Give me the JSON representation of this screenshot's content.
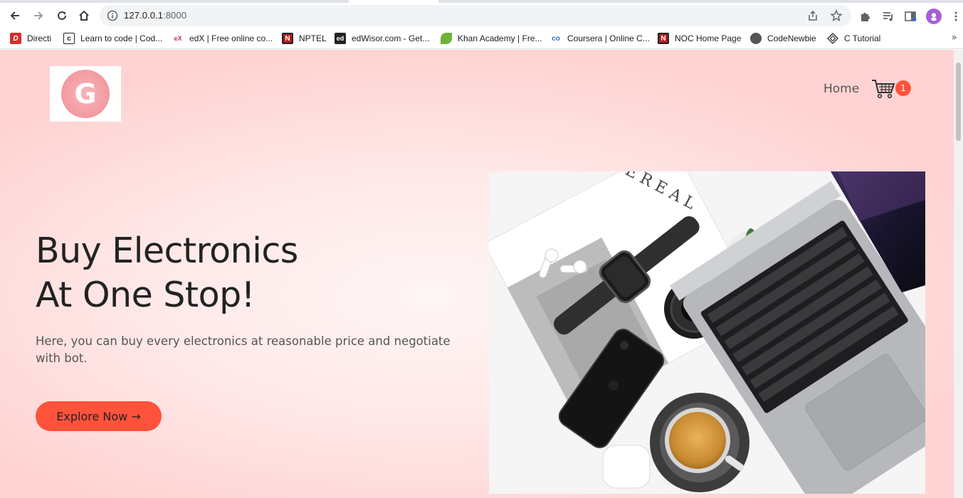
{
  "browser": {
    "url_host": "127.0.0.1",
    "url_port": ":8000",
    "bookmarks": [
      {
        "label": "Directi",
        "icon": "directi-icon",
        "badge": "D",
        "color": "#d32f2f"
      },
      {
        "label": "Learn to code | Cod...",
        "icon": "codecademy-icon",
        "badge": "c",
        "color": "#ffffff"
      },
      {
        "label": "edX | Free online co...",
        "icon": "edx-icon",
        "badge": "eX",
        "color": "#ffffff"
      },
      {
        "label": "NPTEL",
        "icon": "nptel-icon",
        "badge": "N",
        "color": "#b71c1c"
      },
      {
        "label": "edWisor.com - Get...",
        "icon": "edwisor-icon",
        "badge": "ed",
        "color": "#222222"
      },
      {
        "label": "Khan Academy | Fre...",
        "icon": "khan-academy-icon",
        "badge": "",
        "color": "#6fb23b"
      },
      {
        "label": "Coursera | Online C...",
        "icon": "coursera-icon",
        "badge": "co",
        "color": "#ffffff"
      },
      {
        "label": "NOC Home Page",
        "icon": "noc-icon",
        "badge": "N",
        "color": "#b71c1c"
      },
      {
        "label": "CodeNewbie",
        "icon": "codenewbie-icon",
        "badge": "",
        "color": "#555555"
      },
      {
        "label": "C Tutorial",
        "icon": "c-tutorial-icon",
        "badge": "",
        "color": "#ffffff"
      }
    ],
    "more_label": "»"
  },
  "site": {
    "logo_letter": "G",
    "nav": {
      "home": "Home",
      "cart_count": "1"
    },
    "hero": {
      "title_line1": "Buy Electronics",
      "title_line2": "At One Stop!",
      "text": "Here, you can buy every electronics at reasonable price and negotiate with bot.",
      "button": "Explore Now →"
    },
    "image_magazine_text": "CEREAL"
  },
  "colors": {
    "accent": "#ff523b",
    "background": "#ffd6d6"
  }
}
